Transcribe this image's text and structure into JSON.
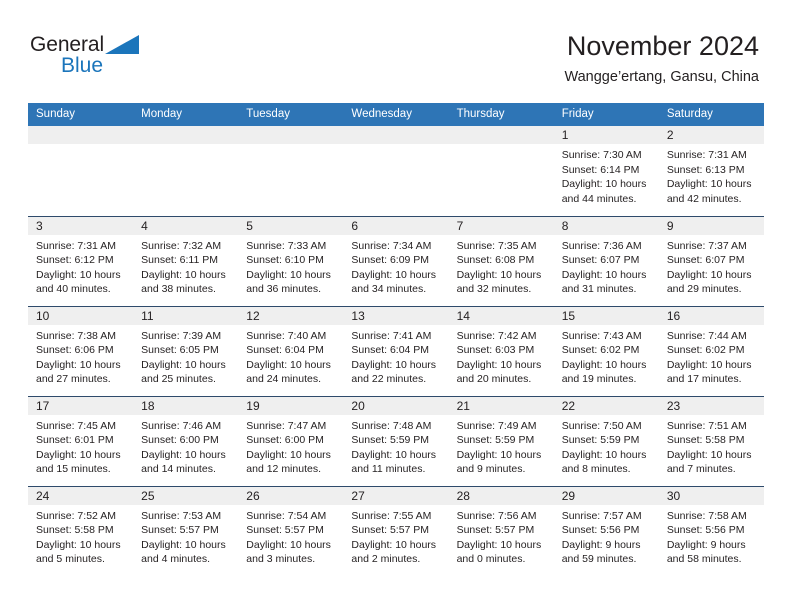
{
  "brand": {
    "name_part1": "General",
    "name_part2": "Blue",
    "triangle_icon": "triangle-icon",
    "accent_color": "#1b75bb"
  },
  "header": {
    "title": "November 2024",
    "subtitle": "Wangge’ertang, Gansu, China"
  },
  "theme": {
    "header_row_bg": "#2e75b6",
    "daynum_strip_bg": "#efefef",
    "row_divider": "#2e4a6b",
    "text_color": "#231f20"
  },
  "weekday_headers": [
    "Sunday",
    "Monday",
    "Tuesday",
    "Wednesday",
    "Thursday",
    "Friday",
    "Saturday"
  ],
  "weeks": [
    [
      {
        "day": "",
        "empty": true
      },
      {
        "day": "",
        "empty": true
      },
      {
        "day": "",
        "empty": true
      },
      {
        "day": "",
        "empty": true
      },
      {
        "day": "",
        "empty": true
      },
      {
        "day": "1",
        "sunrise": "Sunrise: 7:30 AM",
        "sunset": "Sunset: 6:14 PM",
        "daylight_line1": "Daylight: 10 hours",
        "daylight_line2": "and 44 minutes."
      },
      {
        "day": "2",
        "sunrise": "Sunrise: 7:31 AM",
        "sunset": "Sunset: 6:13 PM",
        "daylight_line1": "Daylight: 10 hours",
        "daylight_line2": "and 42 minutes."
      }
    ],
    [
      {
        "day": "3",
        "sunrise": "Sunrise: 7:31 AM",
        "sunset": "Sunset: 6:12 PM",
        "daylight_line1": "Daylight: 10 hours",
        "daylight_line2": "and 40 minutes."
      },
      {
        "day": "4",
        "sunrise": "Sunrise: 7:32 AM",
        "sunset": "Sunset: 6:11 PM",
        "daylight_line1": "Daylight: 10 hours",
        "daylight_line2": "and 38 minutes."
      },
      {
        "day": "5",
        "sunrise": "Sunrise: 7:33 AM",
        "sunset": "Sunset: 6:10 PM",
        "daylight_line1": "Daylight: 10 hours",
        "daylight_line2": "and 36 minutes."
      },
      {
        "day": "6",
        "sunrise": "Sunrise: 7:34 AM",
        "sunset": "Sunset: 6:09 PM",
        "daylight_line1": "Daylight: 10 hours",
        "daylight_line2": "and 34 minutes."
      },
      {
        "day": "7",
        "sunrise": "Sunrise: 7:35 AM",
        "sunset": "Sunset: 6:08 PM",
        "daylight_line1": "Daylight: 10 hours",
        "daylight_line2": "and 32 minutes."
      },
      {
        "day": "8",
        "sunrise": "Sunrise: 7:36 AM",
        "sunset": "Sunset: 6:07 PM",
        "daylight_line1": "Daylight: 10 hours",
        "daylight_line2": "and 31 minutes."
      },
      {
        "day": "9",
        "sunrise": "Sunrise: 7:37 AM",
        "sunset": "Sunset: 6:07 PM",
        "daylight_line1": "Daylight: 10 hours",
        "daylight_line2": "and 29 minutes."
      }
    ],
    [
      {
        "day": "10",
        "sunrise": "Sunrise: 7:38 AM",
        "sunset": "Sunset: 6:06 PM",
        "daylight_line1": "Daylight: 10 hours",
        "daylight_line2": "and 27 minutes."
      },
      {
        "day": "11",
        "sunrise": "Sunrise: 7:39 AM",
        "sunset": "Sunset: 6:05 PM",
        "daylight_line1": "Daylight: 10 hours",
        "daylight_line2": "and 25 minutes."
      },
      {
        "day": "12",
        "sunrise": "Sunrise: 7:40 AM",
        "sunset": "Sunset: 6:04 PM",
        "daylight_line1": "Daylight: 10 hours",
        "daylight_line2": "and 24 minutes."
      },
      {
        "day": "13",
        "sunrise": "Sunrise: 7:41 AM",
        "sunset": "Sunset: 6:04 PM",
        "daylight_line1": "Daylight: 10 hours",
        "daylight_line2": "and 22 minutes."
      },
      {
        "day": "14",
        "sunrise": "Sunrise: 7:42 AM",
        "sunset": "Sunset: 6:03 PM",
        "daylight_line1": "Daylight: 10 hours",
        "daylight_line2": "and 20 minutes."
      },
      {
        "day": "15",
        "sunrise": "Sunrise: 7:43 AM",
        "sunset": "Sunset: 6:02 PM",
        "daylight_line1": "Daylight: 10 hours",
        "daylight_line2": "and 19 minutes."
      },
      {
        "day": "16",
        "sunrise": "Sunrise: 7:44 AM",
        "sunset": "Sunset: 6:02 PM",
        "daylight_line1": "Daylight: 10 hours",
        "daylight_line2": "and 17 minutes."
      }
    ],
    [
      {
        "day": "17",
        "sunrise": "Sunrise: 7:45 AM",
        "sunset": "Sunset: 6:01 PM",
        "daylight_line1": "Daylight: 10 hours",
        "daylight_line2": "and 15 minutes."
      },
      {
        "day": "18",
        "sunrise": "Sunrise: 7:46 AM",
        "sunset": "Sunset: 6:00 PM",
        "daylight_line1": "Daylight: 10 hours",
        "daylight_line2": "and 14 minutes."
      },
      {
        "day": "19",
        "sunrise": "Sunrise: 7:47 AM",
        "sunset": "Sunset: 6:00 PM",
        "daylight_line1": "Daylight: 10 hours",
        "daylight_line2": "and 12 minutes."
      },
      {
        "day": "20",
        "sunrise": "Sunrise: 7:48 AM",
        "sunset": "Sunset: 5:59 PM",
        "daylight_line1": "Daylight: 10 hours",
        "daylight_line2": "and 11 minutes."
      },
      {
        "day": "21",
        "sunrise": "Sunrise: 7:49 AM",
        "sunset": "Sunset: 5:59 PM",
        "daylight_line1": "Daylight: 10 hours",
        "daylight_line2": "and 9 minutes."
      },
      {
        "day": "22",
        "sunrise": "Sunrise: 7:50 AM",
        "sunset": "Sunset: 5:59 PM",
        "daylight_line1": "Daylight: 10 hours",
        "daylight_line2": "and 8 minutes."
      },
      {
        "day": "23",
        "sunrise": "Sunrise: 7:51 AM",
        "sunset": "Sunset: 5:58 PM",
        "daylight_line1": "Daylight: 10 hours",
        "daylight_line2": "and 7 minutes."
      }
    ],
    [
      {
        "day": "24",
        "sunrise": "Sunrise: 7:52 AM",
        "sunset": "Sunset: 5:58 PM",
        "daylight_line1": "Daylight: 10 hours",
        "daylight_line2": "and 5 minutes."
      },
      {
        "day": "25",
        "sunrise": "Sunrise: 7:53 AM",
        "sunset": "Sunset: 5:57 PM",
        "daylight_line1": "Daylight: 10 hours",
        "daylight_line2": "and 4 minutes."
      },
      {
        "day": "26",
        "sunrise": "Sunrise: 7:54 AM",
        "sunset": "Sunset: 5:57 PM",
        "daylight_line1": "Daylight: 10 hours",
        "daylight_line2": "and 3 minutes."
      },
      {
        "day": "27",
        "sunrise": "Sunrise: 7:55 AM",
        "sunset": "Sunset: 5:57 PM",
        "daylight_line1": "Daylight: 10 hours",
        "daylight_line2": "and 2 minutes."
      },
      {
        "day": "28",
        "sunrise": "Sunrise: 7:56 AM",
        "sunset": "Sunset: 5:57 PM",
        "daylight_line1": "Daylight: 10 hours",
        "daylight_line2": "and 0 minutes."
      },
      {
        "day": "29",
        "sunrise": "Sunrise: 7:57 AM",
        "sunset": "Sunset: 5:56 PM",
        "daylight_line1": "Daylight: 9 hours",
        "daylight_line2": "and 59 minutes."
      },
      {
        "day": "30",
        "sunrise": "Sunrise: 7:58 AM",
        "sunset": "Sunset: 5:56 PM",
        "daylight_line1": "Daylight: 9 hours",
        "daylight_line2": "and 58 minutes."
      }
    ]
  ]
}
